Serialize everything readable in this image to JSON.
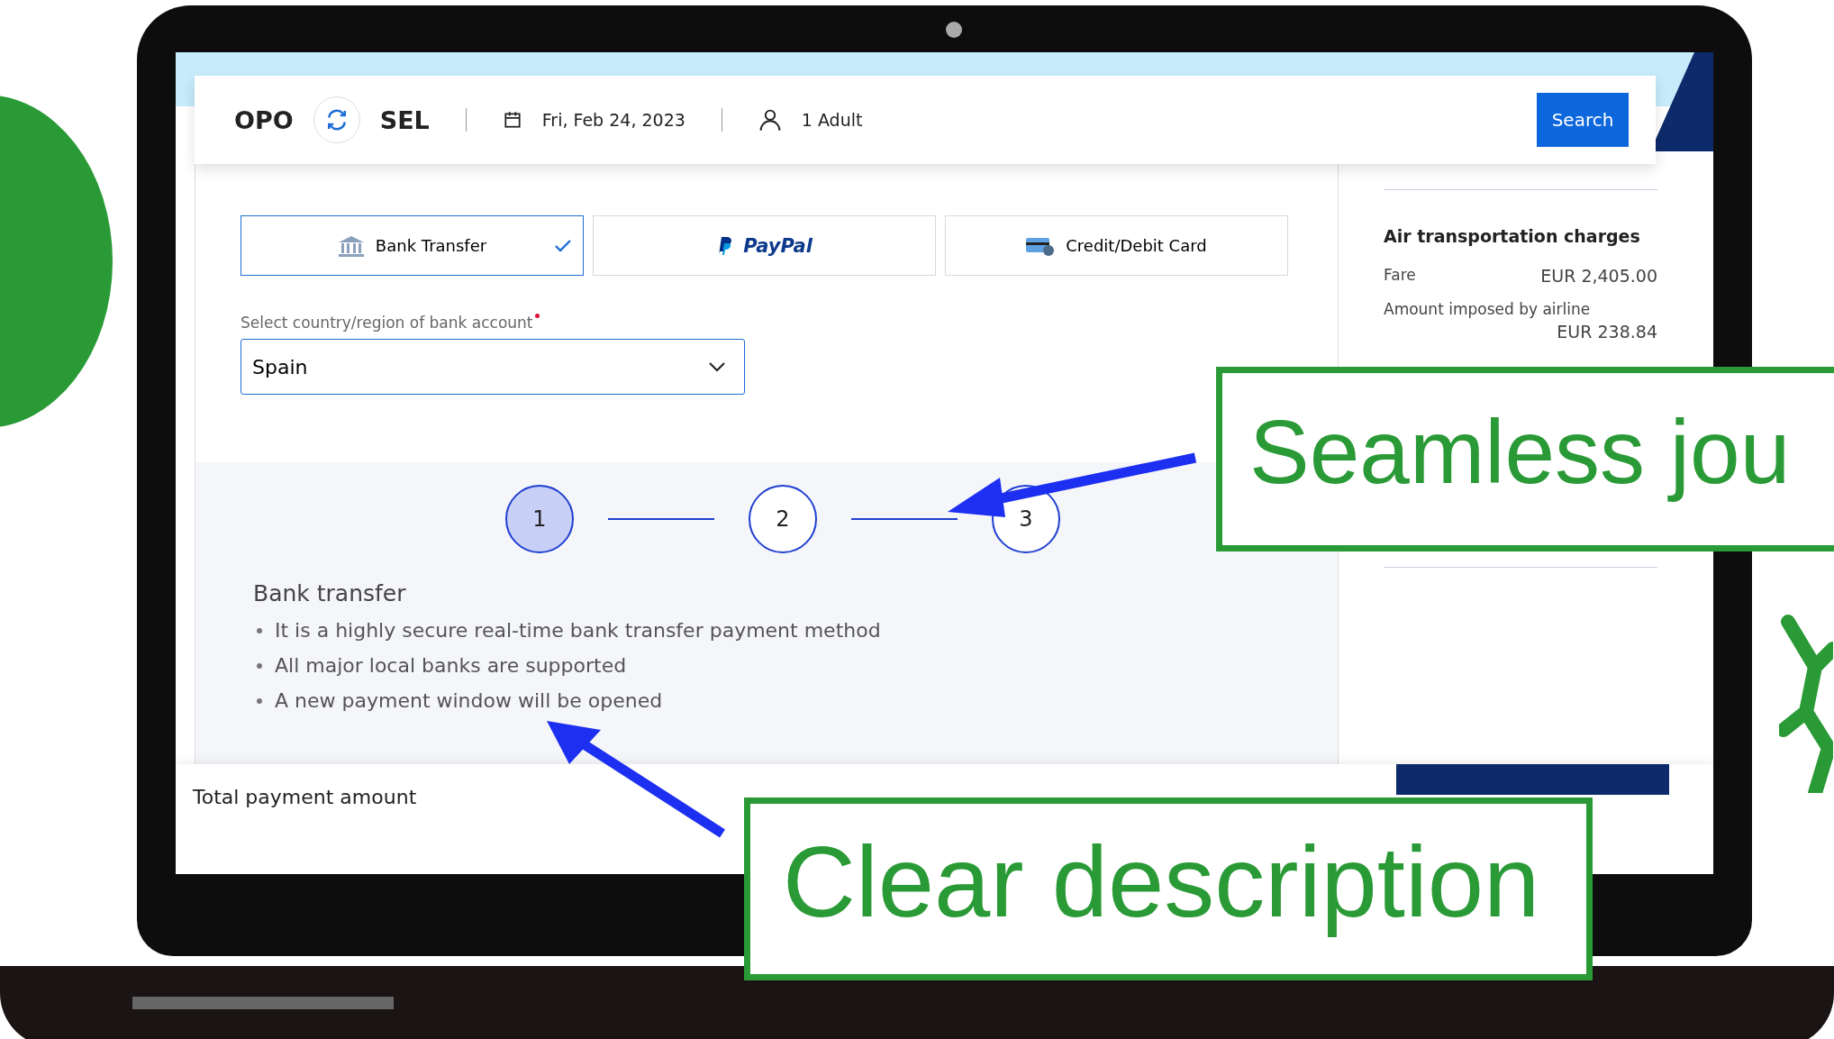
{
  "header": {
    "origin": "OPO",
    "destination": "SEL",
    "date": "Fri, Feb 24, 2023",
    "passengers": "1 Adult",
    "search_button": "Search"
  },
  "payment_methods": [
    {
      "kind": "bank",
      "label": "Bank Transfer",
      "selected": true
    },
    {
      "kind": "paypal",
      "label": "PayPal",
      "selected": false
    },
    {
      "kind": "card",
      "label": "Credit/Debit Card",
      "selected": false
    }
  ],
  "country_field": {
    "label": "Select country/region of bank account",
    "required": true,
    "value": "Spain"
  },
  "steps": [
    {
      "label": "1",
      "selected": true
    },
    {
      "label": "2",
      "selected": false
    },
    {
      "label": "3",
      "selected": false
    }
  ],
  "description": {
    "title": "Bank transfer",
    "bullets": [
      "It is a highly secure real-time bank transfer payment method",
      "All major local banks are supported",
      "A new payment window will be opened"
    ]
  },
  "summary": {
    "title": "Air transportation charges",
    "rows": [
      {
        "label": "Fare",
        "value": "EUR 2,405.00"
      },
      {
        "label": "Amount imposed by airline",
        "value": "EUR 238.84"
      }
    ]
  },
  "footer": {
    "total_label": "Total payment amount"
  },
  "callouts": [
    "Seamless jou",
    "Clear description"
  ]
}
